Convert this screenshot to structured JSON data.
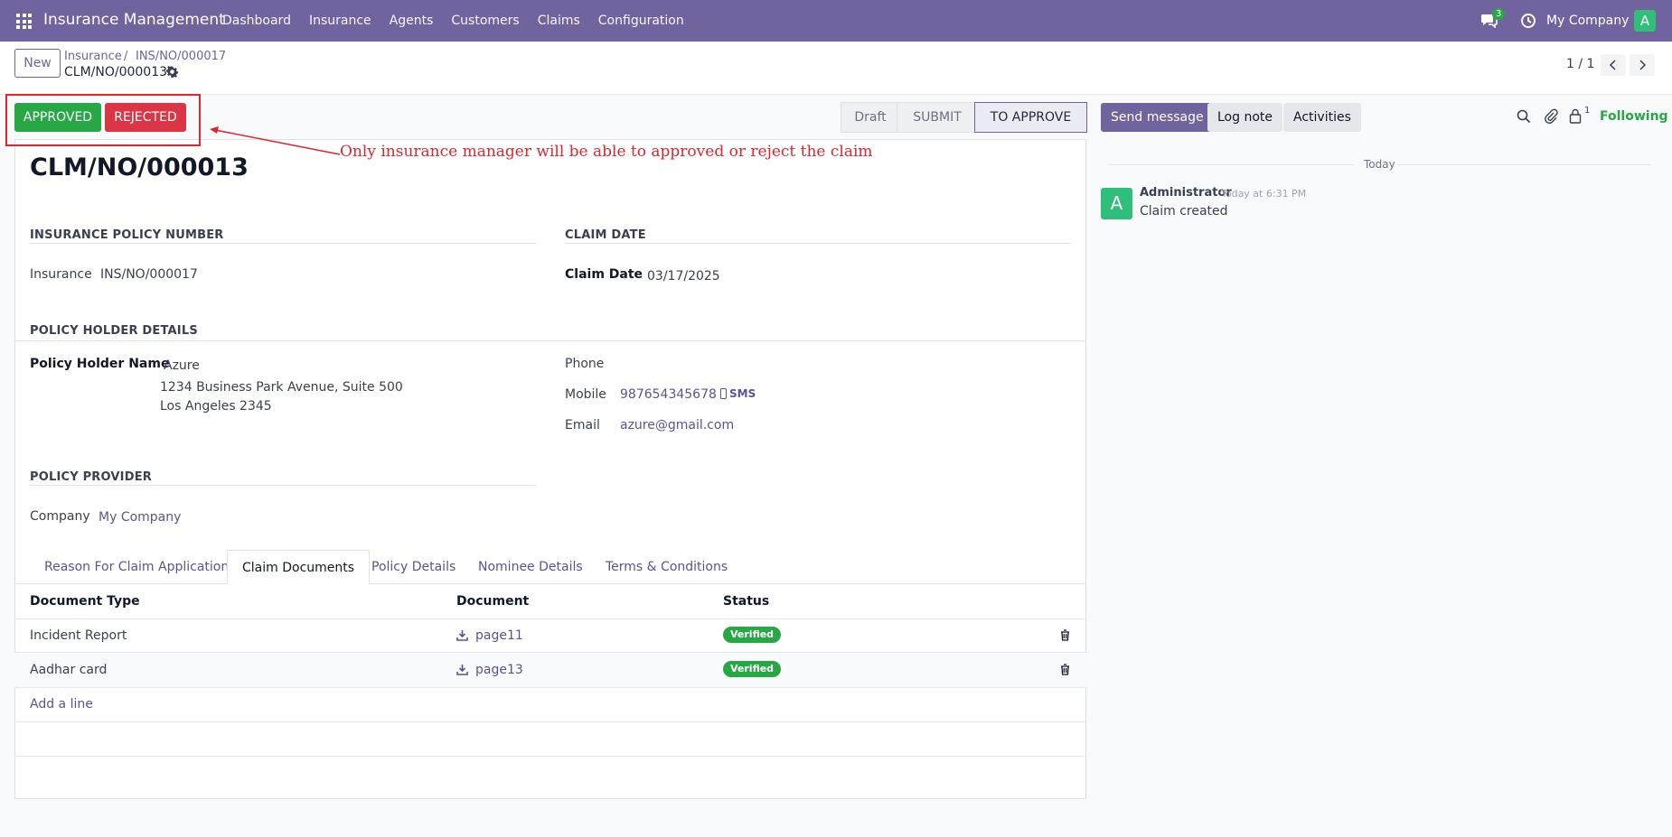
{
  "navbar": {
    "app_title": "Insurance Management",
    "menu": [
      "Dashboard",
      "Insurance",
      "Agents",
      "Customers",
      "Claims",
      "Configuration"
    ],
    "chat_count": "3",
    "company": "My Company",
    "avatar_letter": "A"
  },
  "control": {
    "new_label": "New",
    "breadcrumb": [
      "Insurance",
      "INS/NO/000017"
    ],
    "breadcrumb_sep": "/",
    "current": "CLM/NO/000013",
    "pager": "1 / 1"
  },
  "actions": {
    "approved": "APPROVED",
    "rejected": "REJECTED"
  },
  "annotation": {
    "text": "Only insurance manager will be able to approved or reject the claim",
    "color": "#e0252b"
  },
  "stages": [
    "Draft",
    "SUBMIT",
    "TO APPROVE"
  ],
  "form": {
    "title": "CLM/NO/000013",
    "policy_section": "INSURANCE POLICY NUMBER",
    "insurance_label": "Insurance",
    "insurance_value": "INS/NO/000017",
    "claim_section": "CLAIM DATE",
    "claim_date_label": "Claim Date",
    "claim_date_value": "03/17/2025",
    "holder_section": "POLICY HOLDER DETAILS",
    "holder_name_label": "Policy Holder Name",
    "holder_name": "Azure",
    "holder_address1": "1234 Business Park Avenue, Suite 500",
    "holder_address2": "Los Angeles 2345",
    "phone_label": "Phone",
    "mobile_label": "Mobile",
    "mobile_value": "987654345678",
    "sms_label": "SMS",
    "email_label": "Email",
    "email_value": "azure@gmail.com",
    "provider_section": "POLICY PROVIDER",
    "company_label": "Company",
    "company_value": "My Company"
  },
  "tabs": [
    "Reason For Claim Application",
    "Claim Documents",
    "Policy Details",
    "Nominee Details",
    "Terms & Conditions"
  ],
  "documents": {
    "headers": [
      "Document Type",
      "Document",
      "Status"
    ],
    "rows": [
      {
        "type": "Incident Report",
        "document": "page11",
        "status": "Verified"
      },
      {
        "type": "Aadhar card",
        "document": "page13",
        "status": "Verified"
      }
    ],
    "add_line": "Add a line"
  },
  "chatter": {
    "send_message": "Send message",
    "log_note": "Log note",
    "activities": "Activities",
    "follower_count": "1",
    "following": "Following",
    "today": "Today",
    "author": "Administrator",
    "time": "Today at 6:31 PM",
    "avatar_letter": "A",
    "body": "Claim created"
  }
}
